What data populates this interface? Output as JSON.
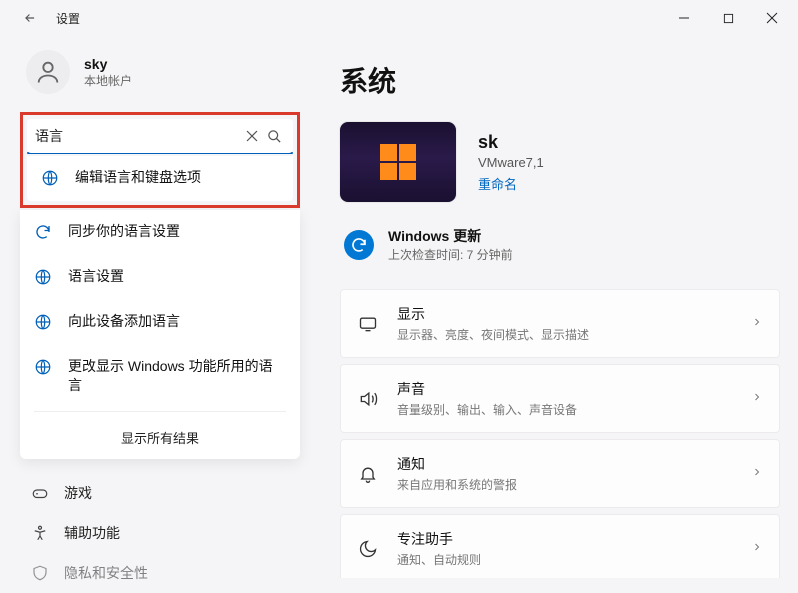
{
  "window": {
    "title": "设置"
  },
  "user": {
    "name": "sky",
    "type": "本地帐户"
  },
  "search": {
    "value": "语言"
  },
  "suggestions": [
    "编辑语言和键盘选项",
    "同步你的语言设置",
    "语言设置",
    "向此设备添加语言",
    "更改显示 Windows 功能所用的语言"
  ],
  "show_all": "显示所有结果",
  "nav": [
    {
      "label": "游戏"
    },
    {
      "label": "辅助功能"
    },
    {
      "label": "隐私和安全性"
    }
  ],
  "page": {
    "title": "系统"
  },
  "device": {
    "name": "sk",
    "model": "VMware7,1",
    "rename": "重命名"
  },
  "update": {
    "title": "Windows 更新",
    "sub": "上次检查时间: 7 分钟前"
  },
  "cards": [
    {
      "title": "显示",
      "sub": "显示器、亮度、夜间模式、显示描述"
    },
    {
      "title": "声音",
      "sub": "音量级别、输出、输入、声音设备"
    },
    {
      "title": "通知",
      "sub": "来自应用和系统的警报"
    },
    {
      "title": "专注助手",
      "sub": "通知、自动规则"
    }
  ]
}
